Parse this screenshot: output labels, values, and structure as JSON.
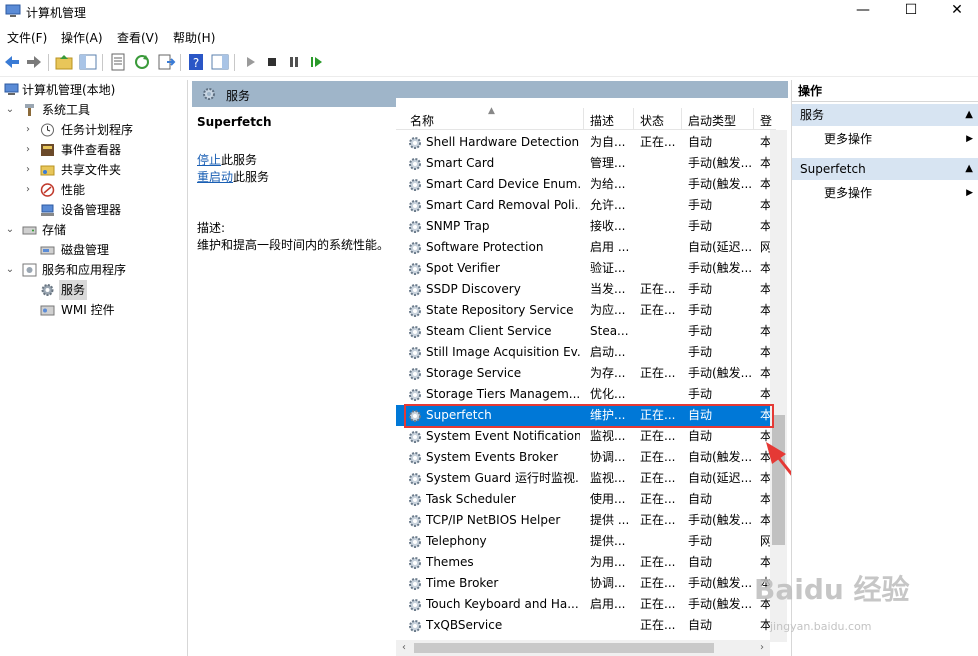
{
  "window": {
    "title": "计算机管理",
    "minimize": "—",
    "maximize": "☐",
    "close": "✕"
  },
  "menu": [
    "文件(F)",
    "操作(A)",
    "查看(V)",
    "帮助(H)"
  ],
  "tree": {
    "root": "计算机管理(本地)",
    "items": [
      {
        "label": "系统工具",
        "icon": "tools-icon"
      },
      {
        "label": "任务计划程序",
        "icon": "clock-icon"
      },
      {
        "label": "事件查看器",
        "icon": "event-viewer-icon"
      },
      {
        "label": "共享文件夹",
        "icon": "shared-folder-icon"
      },
      {
        "label": "性能",
        "icon": "performance-icon"
      },
      {
        "label": "设备管理器",
        "icon": "device-manager-icon"
      },
      {
        "label": "存储",
        "icon": "storage-icon"
      },
      {
        "label": "磁盘管理",
        "icon": "disk-icon"
      },
      {
        "label": "服务和应用程序",
        "icon": "services-apps-icon"
      },
      {
        "label": "服务",
        "icon": "gear-icon"
      },
      {
        "label": "WMI 控件",
        "icon": "wmi-icon"
      }
    ]
  },
  "center": {
    "header": "服务",
    "selected_title": "Superfetch",
    "stop_link": "停止",
    "stop_suffix": "此服务",
    "restart_link": "重启动",
    "restart_suffix": "此服务",
    "desc_label": "描述:",
    "desc_text": "维护和提高一段时间内的系统性能。"
  },
  "columns": {
    "name": "名称",
    "desc": "描述",
    "status": "状态",
    "startup": "启动类型",
    "logon": "登"
  },
  "services": [
    {
      "name": "Shell Hardware Detection",
      "desc": "为自...",
      "status": "正在...",
      "startup": "自动",
      "logon": "本"
    },
    {
      "name": "Smart Card",
      "desc": "管理...",
      "status": "",
      "startup": "手动(触发...",
      "logon": "本"
    },
    {
      "name": "Smart Card Device Enum...",
      "desc": "为给...",
      "status": "",
      "startup": "手动(触发...",
      "logon": "本"
    },
    {
      "name": "Smart Card Removal Poli...",
      "desc": "允许...",
      "status": "",
      "startup": "手动",
      "logon": "本"
    },
    {
      "name": "SNMP Trap",
      "desc": "接收...",
      "status": "",
      "startup": "手动",
      "logon": "本"
    },
    {
      "name": "Software Protection",
      "desc": "启用 ...",
      "status": "",
      "startup": "自动(延迟...",
      "logon": "网"
    },
    {
      "name": "Spot Verifier",
      "desc": "验证...",
      "status": "",
      "startup": "手动(触发...",
      "logon": "本"
    },
    {
      "name": "SSDP Discovery",
      "desc": "当发...",
      "status": "正在...",
      "startup": "手动",
      "logon": "本"
    },
    {
      "name": "State Repository Service",
      "desc": "为应...",
      "status": "正在...",
      "startup": "手动",
      "logon": "本"
    },
    {
      "name": "Steam Client Service",
      "desc": "Stea...",
      "status": "",
      "startup": "手动",
      "logon": "本"
    },
    {
      "name": "Still Image Acquisition Ev...",
      "desc": "启动...",
      "status": "",
      "startup": "手动",
      "logon": "本"
    },
    {
      "name": "Storage Service",
      "desc": "为存...",
      "status": "正在...",
      "startup": "手动(触发...",
      "logon": "本"
    },
    {
      "name": "Storage Tiers Managem...",
      "desc": "优化...",
      "status": "",
      "startup": "手动",
      "logon": "本"
    },
    {
      "name": "Superfetch",
      "desc": "维护...",
      "status": "正在...",
      "startup": "自动",
      "logon": "本"
    },
    {
      "name": "System Event Notification...",
      "desc": "监视...",
      "status": "正在...",
      "startup": "自动",
      "logon": "本"
    },
    {
      "name": "System Events Broker",
      "desc": "协调...",
      "status": "正在...",
      "startup": "自动(触发...",
      "logon": "本"
    },
    {
      "name": "System Guard 运行时监视...",
      "desc": "监视...",
      "status": "正在...",
      "startup": "自动(延迟...",
      "logon": "本"
    },
    {
      "name": "Task Scheduler",
      "desc": "使用...",
      "status": "正在...",
      "startup": "自动",
      "logon": "本"
    },
    {
      "name": "TCP/IP NetBIOS Helper",
      "desc": "提供 ...",
      "status": "正在...",
      "startup": "手动(触发...",
      "logon": "本"
    },
    {
      "name": "Telephony",
      "desc": "提供...",
      "status": "",
      "startup": "手动",
      "logon": "网"
    },
    {
      "name": "Themes",
      "desc": "为用...",
      "status": "正在...",
      "startup": "自动",
      "logon": "本"
    },
    {
      "name": "Time Broker",
      "desc": "协调...",
      "status": "正在...",
      "startup": "手动(触发...",
      "logon": "本"
    },
    {
      "name": "Touch Keyboard and Ha...",
      "desc": "启用...",
      "status": "正在...",
      "startup": "手动(触发...",
      "logon": "本"
    },
    {
      "name": "TxQBService",
      "desc": "",
      "status": "正在...",
      "startup": "自动",
      "logon": "本"
    }
  ],
  "selected_service_index": 13,
  "actions": {
    "title": "操作",
    "sections": [
      {
        "label": "服务",
        "item": "更多操作"
      },
      {
        "label": "Superfetch",
        "item": "更多操作"
      }
    ]
  },
  "watermark": {
    "text": "Baidu 经验",
    "sub": "jingyan.baidu.com"
  },
  "colors": {
    "selection": "#0078d7",
    "header": "#9fb5c9",
    "highlight": "#e53935",
    "action_section": "#d7e4f2"
  }
}
